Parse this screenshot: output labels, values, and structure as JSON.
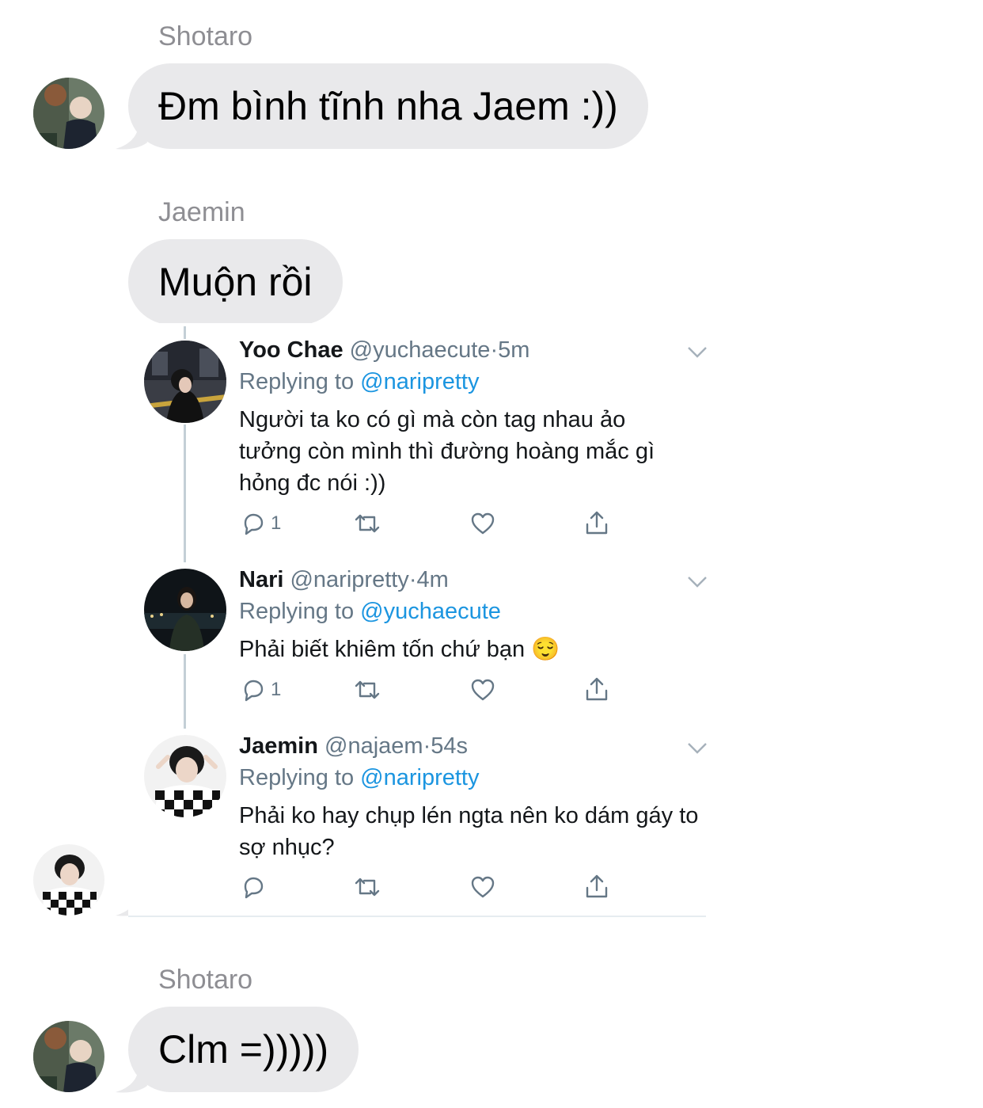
{
  "messages": [
    {
      "sender": "Shotaro",
      "text": "Đm bình tĩnh nha Jaem :))"
    },
    {
      "sender": "Jaemin",
      "text": "Muộn rồi"
    },
    {
      "sender": "Shotaro",
      "text": "Clm =)))))"
    }
  ],
  "tweets": [
    {
      "name": "Yoo Chae",
      "handle": "@yuchaecute",
      "sep": "·",
      "time": "5m",
      "replying_prefix": "Replying to ",
      "replying_to": "@naripretty",
      "text": "Người ta ko có gì mà còn tag nhau ảo tưởng còn mình thì đường hoàng mắc gì hỏng đc nói :))",
      "reply_count": "1"
    },
    {
      "name": "Nari",
      "handle": "@naripretty",
      "sep": "·",
      "time": "4m",
      "replying_prefix": "Replying to ",
      "replying_to": "@yuchaecute",
      "text": "Phải biết khiêm tốn chứ bạn 😌",
      "reply_count": "1"
    },
    {
      "name": "Jaemin",
      "handle": "@najaem",
      "sep": "·",
      "time": "54s",
      "replying_prefix": "Replying to ",
      "replying_to": "@naripretty",
      "text": "Phải ko hay chụp lén ngta nên ko dám gáy to sợ nhục?",
      "reply_count": ""
    }
  ],
  "colors": {
    "bubble": "#e9e9eb",
    "mention": "#1b95e0",
    "muted": "#657786",
    "sender": "#8e8e93"
  },
  "icons": [
    "reply-icon",
    "retweet-icon",
    "like-icon",
    "share-icon",
    "chevron-down-icon"
  ]
}
